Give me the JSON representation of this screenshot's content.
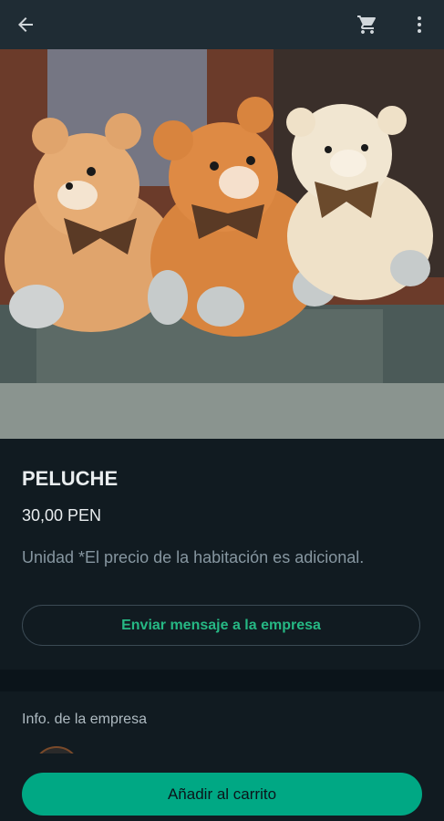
{
  "product": {
    "title": "PELUCHE",
    "price": "30,00 PEN",
    "description": "Unidad *El precio de la habitación es adicional."
  },
  "actions": {
    "message_label": "Enviar mensaje a la empresa",
    "add_to_cart_label": "Añadir al carrito"
  },
  "company": {
    "section_label": "Info. de la empresa"
  },
  "icons": {
    "back": "arrow-left-icon",
    "cart": "shopping-cart-icon",
    "more": "more-vertical-icon"
  },
  "colors": {
    "accent": "#00a884",
    "background": "#111b21",
    "topbar": "#1f2c34"
  }
}
